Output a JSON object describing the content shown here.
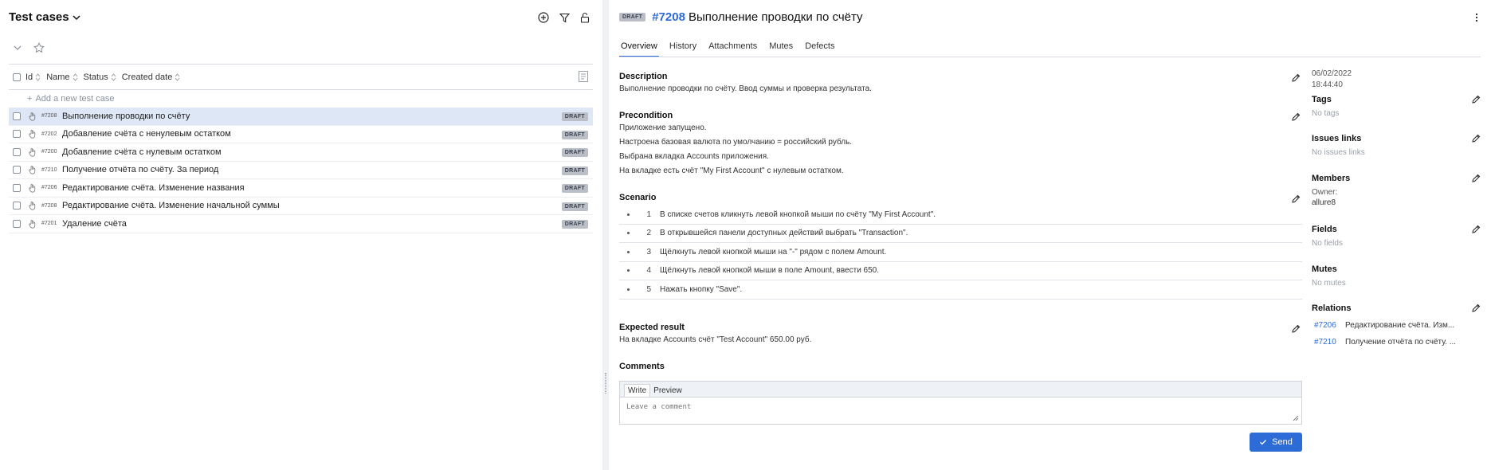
{
  "left": {
    "title": "Test cases",
    "columns": [
      "Id",
      "Name",
      "Status",
      "Created date"
    ],
    "add_label": "Add a new test case",
    "rows": [
      {
        "id": "#7208",
        "name": "Выполнение проводки по счёту",
        "badge": "DRAFT",
        "selected": true
      },
      {
        "id": "#7202",
        "name": "Добавление счёта с ненулевым остатком",
        "badge": "DRAFT"
      },
      {
        "id": "#7200",
        "name": "Добавление счёта с нулевым остатком",
        "badge": "DRAFT"
      },
      {
        "id": "#7210",
        "name": "Получение отчёта по счёту. За период",
        "badge": "DRAFT"
      },
      {
        "id": "#7206",
        "name": "Редактирование счёта. Изменение названия",
        "badge": "DRAFT"
      },
      {
        "id": "#7208",
        "name": "Редактирование счёта. Изменение начальной суммы",
        "badge": "DRAFT"
      },
      {
        "id": "#7201",
        "name": "Удаление счёта",
        "badge": "DRAFT"
      }
    ]
  },
  "detail": {
    "badge": "DRAFT",
    "id": "#7208",
    "title": "Выполнение проводки по счёту",
    "tabs": [
      "Overview",
      "History",
      "Attachments",
      "Mutes",
      "Defects"
    ],
    "description_title": "Description",
    "description": "Выполнение проводки по счёту. Ввод суммы и проверка результата.",
    "precondition_title": "Precondition",
    "precondition_lines": [
      "Приложение запущено.",
      "Настроена базовая валюта по умолчанию = российский рубль.",
      "Выбрана вкладка Accounts приложения.",
      "На вкладке есть счёт \"My First Account\" с нулевым остатком."
    ],
    "scenario_title": "Scenario",
    "steps": [
      {
        "num": "1",
        "text": "В списке счетов кликнуть левой кнопкой мыши по счёту \"My First Account\"."
      },
      {
        "num": "2",
        "text": "В открывшейся панели доступных действий выбрать \"Transaction\"."
      },
      {
        "num": "3",
        "text": "Щёлкнуть левой кнопкой мыши на \"-\" рядом с полем Amount."
      },
      {
        "num": "4",
        "text": "Щёлкнуть левой кнопкой мыши в поле Amount, ввести 650."
      },
      {
        "num": "5",
        "text": "Нажать кнопку \"Save\"."
      }
    ],
    "expected_title": "Expected result",
    "expected": "На вкладке Accounts счёт \"Test Account\" 650.00 руб.",
    "comments_title": "Comments",
    "comment_tabs": [
      "Write",
      "Preview"
    ],
    "comment_placeholder": "Leave a comment",
    "send_label": "Send"
  },
  "sidebar": {
    "date": "06/02/2022",
    "time": "18:44:40",
    "tags_label": "Tags",
    "tags_value": "No tags",
    "issues_label": "Issues links",
    "issues_value": "No issues links",
    "members_label": "Members",
    "owner_label": "Owner:",
    "owner_value": "allure8",
    "fields_label": "Fields",
    "fields_value": "No fields",
    "mutes_label": "Mutes",
    "mutes_value": "No mutes",
    "relations_label": "Relations",
    "relations": [
      {
        "id": "#7206",
        "name": "Редактирование счёта. Изм..."
      },
      {
        "id": "#7210",
        "name": "Получение отчёта по счёту. ..."
      }
    ]
  },
  "colors": {
    "accent": "#2d6bd6",
    "selected_row": "#dde7f6",
    "badge_bg": "#b9bec7"
  }
}
